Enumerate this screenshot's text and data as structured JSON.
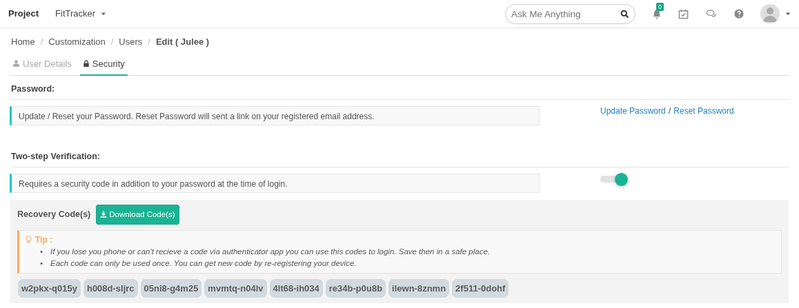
{
  "navbar": {
    "brand": "Project",
    "project": "FitTracker",
    "search": {
      "placeholder": "Ask Me Anything"
    },
    "notification_count": "0"
  },
  "breadcrumb": {
    "separator": "/",
    "items": [
      {
        "label": "Home",
        "active": false
      },
      {
        "label": "Customization",
        "active": false
      },
      {
        "label": "Users",
        "active": false
      },
      {
        "label": "Edit ( Julee )",
        "active": true
      }
    ]
  },
  "tabs": [
    {
      "label": "User Details",
      "kind": "user",
      "selected": false
    },
    {
      "label": "Security",
      "kind": "lock",
      "selected": true
    }
  ],
  "password": {
    "heading": "Password:",
    "info": "Update / Reset your Password. Reset Password will sent a link on your registered email address.",
    "links": [
      "Update Password",
      "Reset Password"
    ],
    "link_separator": "/"
  },
  "two_step": {
    "heading": "Two-step Verification:",
    "info": "Requires a security code in addition to your password at the time of login.",
    "on": true
  },
  "recovery": {
    "label": "Recovery Code(s)",
    "button": "Download Code(s)",
    "tip_title": "Tip :",
    "tip_bullet": "•",
    "tips": [
      "If you lose you phone or can't recieve a code via authenticator app you can use this codes to login. Save then in a safe place.",
      "Each code can only be used once. You can get new code by re-registering your device."
    ],
    "codes": [
      "w2pkx-q015y",
      "h008d-sljrc",
      "05ni8-g4m25",
      "mvmtq-n04lv",
      "4lt68-ih034",
      "re34b-p0u8b",
      "ilewn-8znmn",
      "2f511-0dohf"
    ]
  }
}
